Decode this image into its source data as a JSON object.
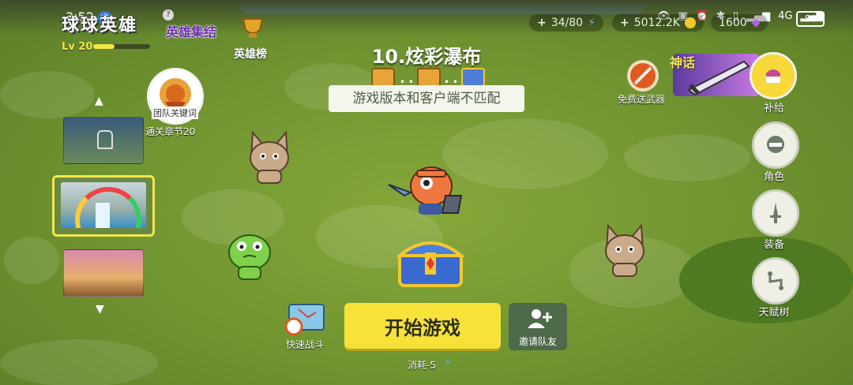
{
  "status_bar": {
    "time": "3:52",
    "battery": "84",
    "network": "4G"
  },
  "game": {
    "logo": "球球英雄",
    "logo_subtitle": "英雄集结",
    "level_label": "Lv 20",
    "rank_label": "英雄榜"
  },
  "resources": {
    "energy": "34/80",
    "coins": "5012.2K",
    "gems": "1600"
  },
  "stage": {
    "title": "10.炫彩瀑布",
    "warning": "游戏版本和客户端不匹配"
  },
  "left_panel": {
    "team_key_label": "团队关键词",
    "chapter_label": "通关章节20"
  },
  "right_panel": {
    "free_weapon_label": "免费送武器",
    "myth_label": "神话",
    "supply_label": "补给",
    "character_label": "角色",
    "equipment_label": "装备",
    "talent_label": "天赋树"
  },
  "bottom": {
    "quick_battle_label": "快速战斗",
    "start_label": "开始游戏",
    "invite_label": "邀请队友",
    "cost_label": "消耗-5"
  },
  "colors": {
    "start_button": "#f7e23a",
    "accent_yellow": "#e8e23a",
    "ground": "#6f9330"
  }
}
